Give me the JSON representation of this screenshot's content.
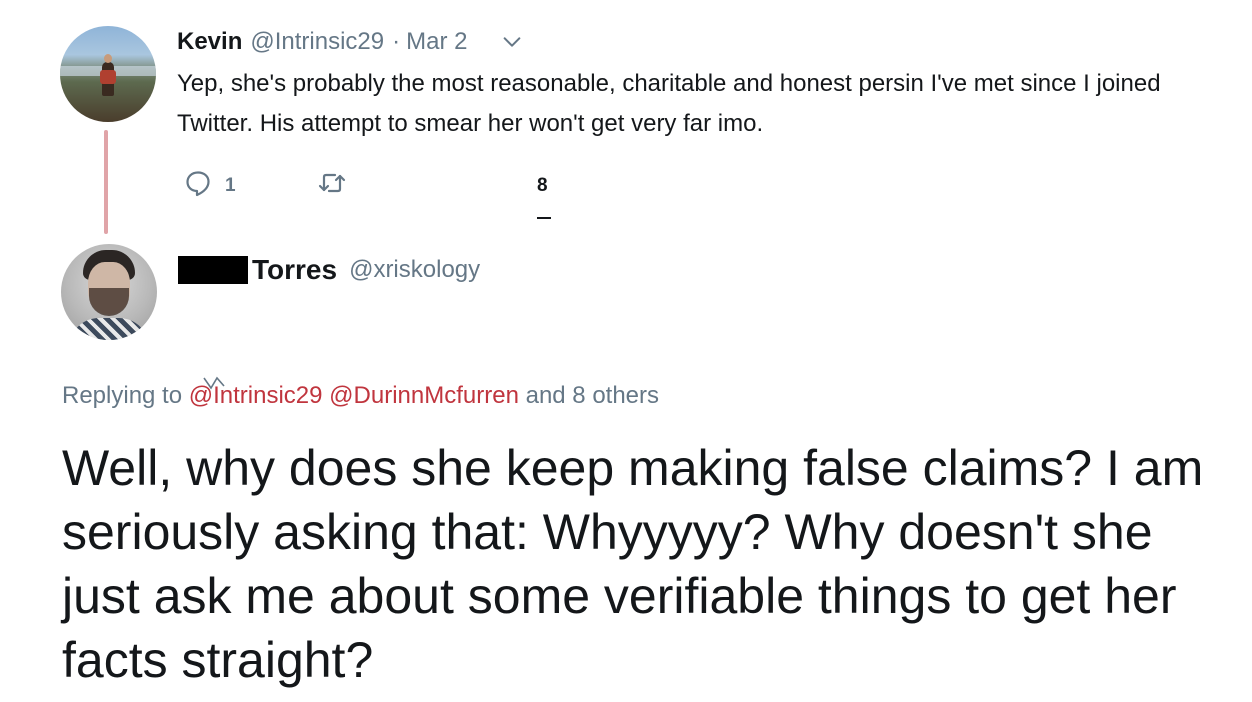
{
  "parent_tweet": {
    "author_name": "Kevin",
    "handle": "@Intrinsic29",
    "separator": "·",
    "date": "Mar 2",
    "text": "Yep, she's probably the most reasonable, charitable and honest persin I've met since I joined Twitter. His attempt to smear her won't get very far imo.",
    "reply_count": "1",
    "retweet_count": "",
    "like_count": "8",
    "icons": [
      "reply-icon",
      "retweet-icon",
      "chevron-down-icon"
    ]
  },
  "reply_tweet": {
    "author_name": "Torres",
    "handle": "@xriskology",
    "replying_prefix": "Replying to",
    "mentions": [
      "@Intrinsic29",
      "@DurinnMcfurren"
    ],
    "replying_suffix": "and 8 others",
    "text": "Well, why does she keep making false claims? I am seriously asking that: Whyyyyy? Why doesn't she just ask me about some verifiable things to get her facts straight?"
  },
  "colors": {
    "text": "#14171a",
    "secondary": "#657786",
    "mention": "#c0353e",
    "thread_line": "#e0a4a8"
  }
}
